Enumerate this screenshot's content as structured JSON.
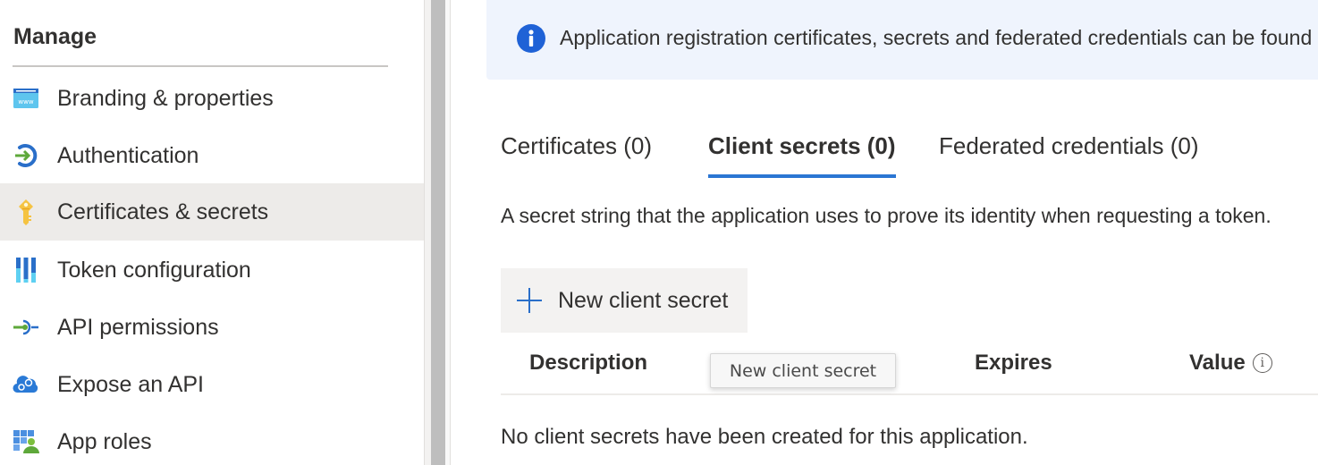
{
  "sidebar": {
    "section_title": "Manage",
    "items": [
      {
        "label": "Branding & properties",
        "icon": "www-window-icon",
        "active": false
      },
      {
        "label": "Authentication",
        "icon": "sign-in-arrow-icon",
        "active": false
      },
      {
        "label": "Certificates & secrets",
        "icon": "key-icon",
        "active": true
      },
      {
        "label": "Token configuration",
        "icon": "token-bars-icon",
        "active": false
      },
      {
        "label": "API permissions",
        "icon": "api-connector-icon",
        "active": false
      },
      {
        "label": "Expose an API",
        "icon": "cloud-gears-icon",
        "active": false
      },
      {
        "label": "App roles",
        "icon": "grid-user-icon",
        "active": false
      }
    ]
  },
  "banner": {
    "icon": "info-icon",
    "text": "Application registration certificates, secrets and federated credentials can be found in the tabs below."
  },
  "tabs": [
    {
      "label": "Certificates (0)",
      "active": false
    },
    {
      "label": "Client secrets (0)",
      "active": true
    },
    {
      "label": "Federated credentials (0)",
      "active": false
    }
  ],
  "description": "A secret string that the application uses to prove its identity when requesting a token.",
  "toolbar": {
    "new_secret_label": "New client secret",
    "new_secret_icon": "plus-icon"
  },
  "table": {
    "columns": [
      "Description",
      "Expires",
      "Value"
    ],
    "value_info_icon": "info-circle-icon",
    "empty_message": "No client secrets have been created for this application."
  },
  "tooltip": {
    "text": "New client secret"
  },
  "colors": {
    "accent": "#2b76d3",
    "info_blue": "#1f62d6",
    "banner_bg": "#eff4fd",
    "active_nav_bg": "#edebe9",
    "button_bg": "#f3f2f1"
  }
}
